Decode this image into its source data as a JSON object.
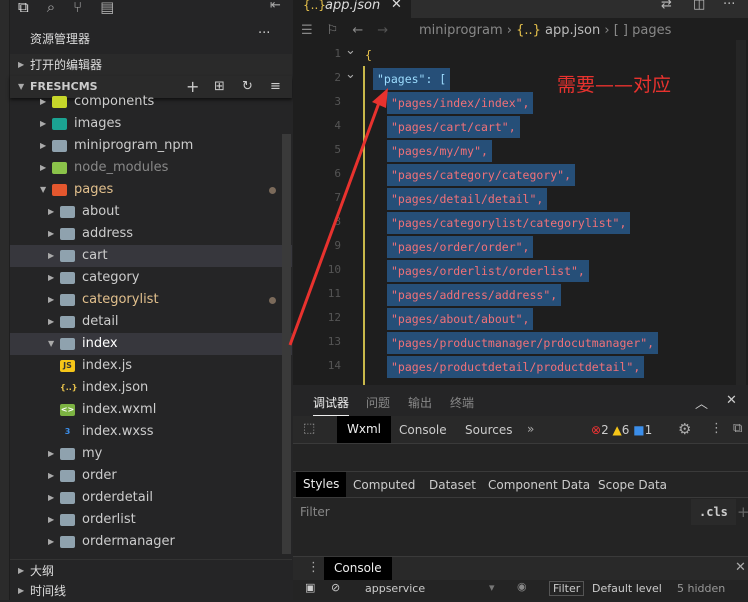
{
  "activity_icons": [
    "files-icon",
    "search-icon",
    "source-control-icon",
    "extensions-icon"
  ],
  "explorer": {
    "title": "资源管理器",
    "more": "···",
    "open_editors": "打开的编辑器",
    "project": "FRESHCMS",
    "outline": "大纲",
    "timeline": "时间线"
  },
  "tree": [
    {
      "label": "components",
      "depth": 0,
      "icon": "components-folder",
      "expanded": false
    },
    {
      "label": "images",
      "depth": 0,
      "icon": "images-folder",
      "expanded": false
    },
    {
      "label": "miniprogram_npm",
      "depth": 0,
      "icon": "folder",
      "expanded": false
    },
    {
      "label": "node_modules",
      "depth": 0,
      "icon": "node-folder",
      "expanded": false,
      "dim": true
    },
    {
      "label": "pages",
      "depth": 0,
      "icon": "pages-folder",
      "expanded": true,
      "modified": true
    },
    {
      "label": "about",
      "depth": 1,
      "icon": "folder"
    },
    {
      "label": "address",
      "depth": 1,
      "icon": "folder"
    },
    {
      "label": "cart",
      "depth": 1,
      "icon": "folder",
      "hover": true
    },
    {
      "label": "category",
      "depth": 1,
      "icon": "folder"
    },
    {
      "label": "categorylist",
      "depth": 1,
      "icon": "folder",
      "modified": true
    },
    {
      "label": "detail",
      "depth": 1,
      "icon": "folder"
    },
    {
      "label": "index",
      "depth": 1,
      "icon": "folder-open",
      "expanded": true,
      "selected": true
    },
    {
      "label": "index.js",
      "depth": 2,
      "icon": "js"
    },
    {
      "label": "index.json",
      "depth": 2,
      "icon": "json"
    },
    {
      "label": "index.wxml",
      "depth": 2,
      "icon": "wxml"
    },
    {
      "label": "index.wxss",
      "depth": 2,
      "icon": "wxss"
    },
    {
      "label": "my",
      "depth": 1,
      "icon": "folder"
    },
    {
      "label": "order",
      "depth": 1,
      "icon": "folder"
    },
    {
      "label": "orderdetail",
      "depth": 1,
      "icon": "folder"
    },
    {
      "label": "orderlist",
      "depth": 1,
      "icon": "folder"
    },
    {
      "label": "ordermanager",
      "depth": 1,
      "icon": "folder"
    }
  ],
  "editor": {
    "tab": "app.json",
    "tab_icon": "{..}",
    "breadcrumb": [
      "miniprogram",
      "app.json",
      "pages"
    ],
    "lines": [
      {
        "n": "1",
        "text": "{"
      },
      {
        "n": "2",
        "text": "\"pages\": ["
      },
      {
        "n": "3",
        "text": "\"pages/index/index\","
      },
      {
        "n": "4",
        "text": "\"pages/cart/cart\","
      },
      {
        "n": "5",
        "text": "\"pages/my/my\","
      },
      {
        "n": "6",
        "text": "\"pages/category/category\","
      },
      {
        "n": "7",
        "text": "\"pages/detail/detail\","
      },
      {
        "n": "8",
        "text": "\"pages/categorylist/categorylist\","
      },
      {
        "n": "9",
        "text": "\"pages/order/order\","
      },
      {
        "n": "10",
        "text": "\"pages/orderlist/orderlist\","
      },
      {
        "n": "11",
        "text": "\"pages/address/address\","
      },
      {
        "n": "12",
        "text": "\"pages/about/about\","
      },
      {
        "n": "13",
        "text": "\"pages/productmanager/prdocutmanager\","
      },
      {
        "n": "14",
        "text": "\"pages/productdetail/productdetail\","
      }
    ],
    "annotation": "需要——对应",
    "annotation_color": "#e8322e"
  },
  "panel": {
    "tabs": [
      "调试器",
      "问题",
      "输出",
      "终端"
    ],
    "devtools_tabs": [
      "Wxml",
      "Console",
      "Sources",
      "»"
    ],
    "errors": "2",
    "warnings": "6",
    "infos": "1",
    "style_tabs": [
      "Styles",
      "Computed",
      "Dataset",
      "Component Data",
      "Scope Data"
    ],
    "filter_placeholder": "Filter",
    "cls": ".cls",
    "plus": "+",
    "drawer_tab": "Console",
    "context": "appservice",
    "filter2": "Filter",
    "level": "Default level",
    "hidden": "5 hidden"
  }
}
